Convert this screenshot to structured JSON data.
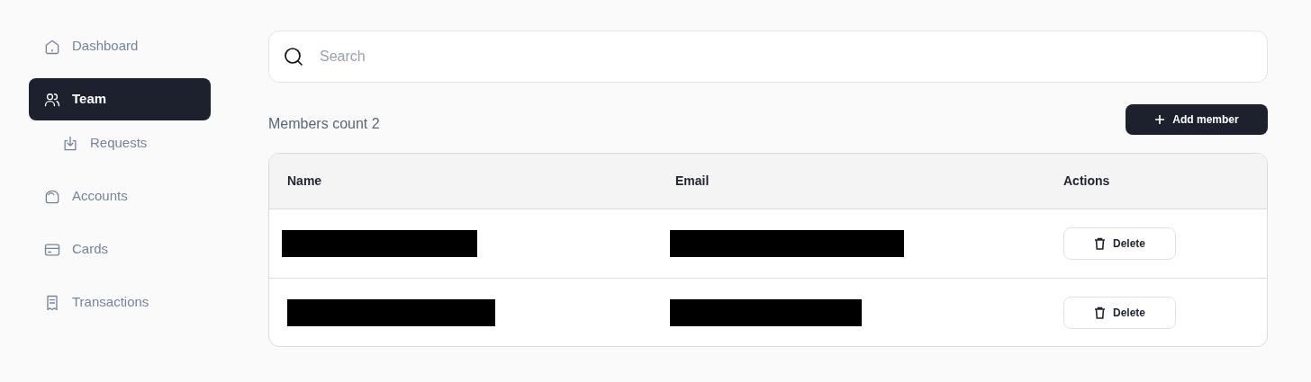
{
  "sidebar": {
    "items": [
      {
        "label": "Dashboard",
        "kind": "home",
        "selected": false
      },
      {
        "label": "Team",
        "kind": "users",
        "selected": true,
        "children": [
          {
            "label": "Requests",
            "kind": "download",
            "selected": false
          }
        ]
      },
      {
        "label": "Accounts",
        "kind": "wallet",
        "selected": false
      },
      {
        "label": "Cards",
        "kind": "card",
        "selected": false
      },
      {
        "label": "Transactions",
        "kind": "receipt",
        "selected": false
      }
    ]
  },
  "search": {
    "placeholder": "Search"
  },
  "members_count": "Members count 2",
  "add_button": "Add member",
  "table": {
    "columns": [
      "Name",
      "Email",
      "Actions"
    ],
    "rows": [
      {
        "name_redacted": true,
        "email_redacted": true,
        "action": "Delete"
      },
      {
        "name_redacted": true,
        "email_redacted": true,
        "action": "Delete"
      }
    ]
  }
}
